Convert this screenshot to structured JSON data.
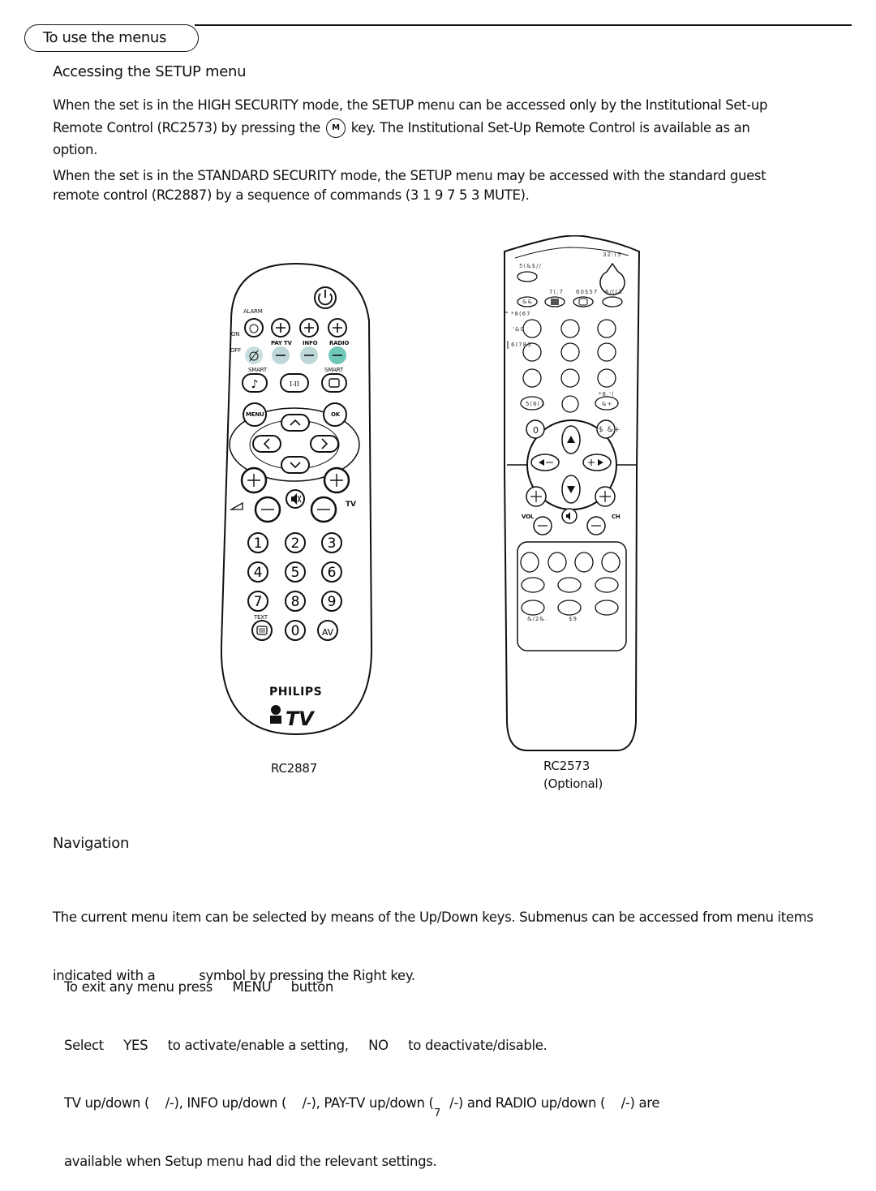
{
  "section_title": "To use the menus",
  "accessing": {
    "heading": "Accessing the SETUP menu",
    "para1_a": "When the set is in the HIGH SECURITY mode, the SETUP menu can be accessed only by the Institutional Set-up",
    "para1_b": "Remote Control (RC2573) by pressing the",
    "para1_key": "M",
    "para1_c": "key. The Institutional Set-Up Remote Control is available as an",
    "para1_d": "option.",
    "para2_a": "When the set is in the STANDARD SECURITY mode, the SETUP menu may be accessed with the standard guest",
    "para2_b": "remote control (RC2887) by a sequence of commands (3 1 9 7 5 3 MUTE)."
  },
  "remote_rc2887": {
    "caption": "RC2887",
    "labels": {
      "alarm": "ALARM",
      "on": "ON",
      "off": "OFF",
      "pay_tv": "PAY TV",
      "info": "INFO",
      "radio": "RADIO",
      "smart_left": "SMART",
      "smart_right": "SMART",
      "mono_stereo": "I-II",
      "menu": "MENU",
      "ok": "OK",
      "tv": "TV",
      "text": "TEXT",
      "av": "AV",
      "brand": "PHILIPS",
      "brand_tv": "TV"
    },
    "digits": [
      "1",
      "2",
      "3",
      "4",
      "5",
      "6",
      "7",
      "8",
      "9",
      "0"
    ],
    "highlight_color": "#6fc7b8"
  },
  "remote_rc2573": {
    "caption": "RC2573",
    "caption_sub": "(Optional)",
    "labels": {
      "power": "32:(5",
      "recall": "5(&$//",
      "text": "7(;7",
      "smart": "60$57",
      "sleep": "6/((3",
      "cc": "&&",
      "guide": "*8(67",
      "dc": "'&0",
      "select": "6(783",
      "reset": "5(6(7",
      "guide2": "*8,'(",
      "ch": "&+",
      "m": "0",
      "sach": "$  &+",
      "vol": "VOL",
      "ch_label": "CH",
      "clock": "&/2&.",
      "av": "$9"
    }
  },
  "navigation": {
    "heading": "Navigation",
    "para_a": "The current menu item can be selected by means of the Up/Down keys. Submenus can be accessed from menu items",
    "para_b": "indicated with a           symbol by pressing the Right key.",
    "line1": "To exit any menu press     MENU     button",
    "line2": "Select     YES     to activate/enable a setting,     NO     to deactivate/disable.",
    "line3": "TV up/down (    /-), INFO up/down (    /-), PAY-TV up/down (    /-) and RADIO up/down (    /-) are",
    "line4": "available when Setup menu had did the relevant settings."
  },
  "page_number": "7"
}
